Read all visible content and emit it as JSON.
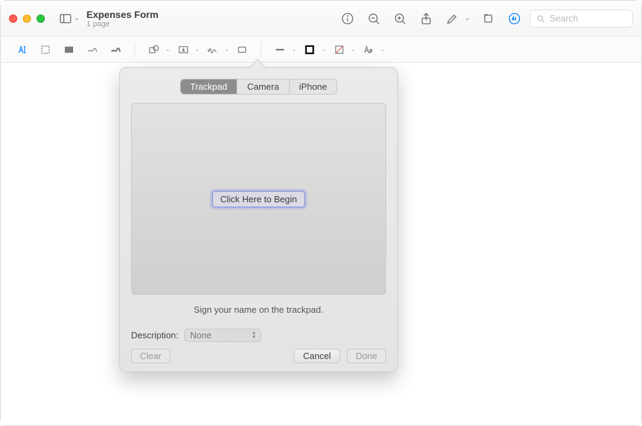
{
  "titlebar": {
    "document_title": "Expenses Form",
    "page_count": "1 page",
    "search_placeholder": "Search"
  },
  "signature_popover": {
    "tabs": {
      "trackpad": "Trackpad",
      "camera": "Camera",
      "iphone": "iPhone"
    },
    "begin_button": "Click Here to Begin",
    "hint": "Sign your name on the trackpad.",
    "description_label": "Description:",
    "description_value": "None",
    "clear": "Clear",
    "cancel": "Cancel",
    "done": "Done"
  }
}
